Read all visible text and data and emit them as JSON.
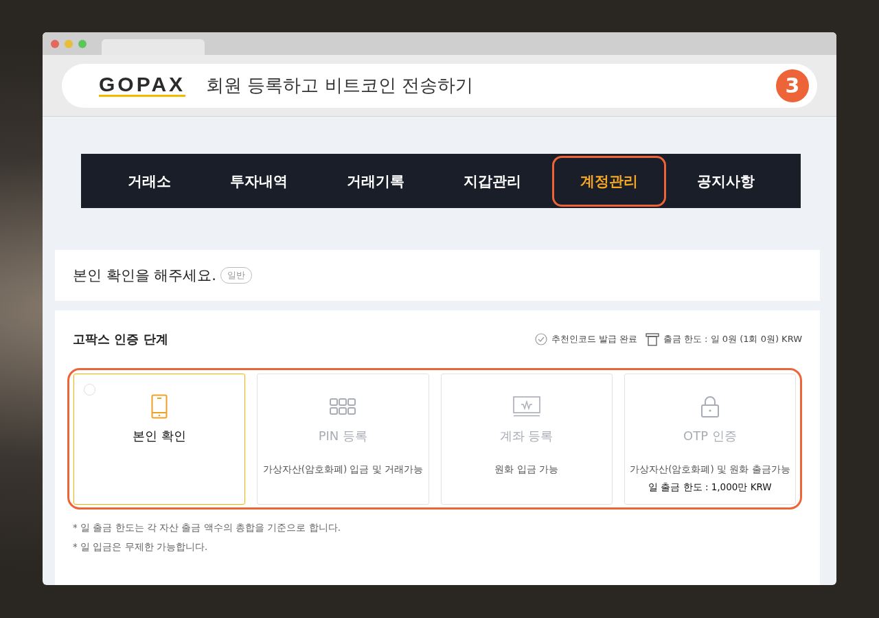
{
  "header": {
    "logo": "GOPAX",
    "title": "회원 등록하고 비트코인 전송하기",
    "step_badge": "3"
  },
  "nav": [
    {
      "label": "거래소",
      "selected": false
    },
    {
      "label": "투자내역",
      "selected": false
    },
    {
      "label": "거래기록",
      "selected": false
    },
    {
      "label": "지갑관리",
      "selected": false
    },
    {
      "label": "계정관리",
      "selected": true
    },
    {
      "label": "공지사항",
      "selected": false
    }
  ],
  "notice": {
    "text": "본인 확인을 해주세요.",
    "badge": "일반"
  },
  "verification": {
    "title": "고팍스 인증 단계",
    "status": [
      {
        "kind": "check",
        "text": "추천인코드 발급 완료"
      },
      {
        "kind": "limit",
        "text": "출금 한도 : 일 0원 (1회 0원) KRW"
      }
    ],
    "highlighted": true,
    "steps": [
      {
        "title": "본인 확인",
        "active": true,
        "checked": false
      },
      {
        "title": "PIN 등록",
        "active": false,
        "lines": [
          {
            "text": "가상자산(암호화폐) 입금 및 거래가능",
            "strong": false
          }
        ]
      },
      {
        "title": "계좌 등록",
        "active": false,
        "lines": [
          {
            "text": "원화 입금 가능",
            "strong": false
          }
        ]
      },
      {
        "title": "OTP 인증",
        "active": false,
        "lines": [
          {
            "text": "가상자산(암호화폐) 및 원화 출금가능",
            "strong": false
          },
          {
            "text": "일 출금 한도 : 1,000만 KRW",
            "strong": true
          }
        ]
      }
    ],
    "footnotes": [
      "* 일 출금 한도는 각 자산 출금 액수의 총합을 기준으로 합니다.",
      "* 일 입금은 무제한 가능합니다."
    ]
  }
}
